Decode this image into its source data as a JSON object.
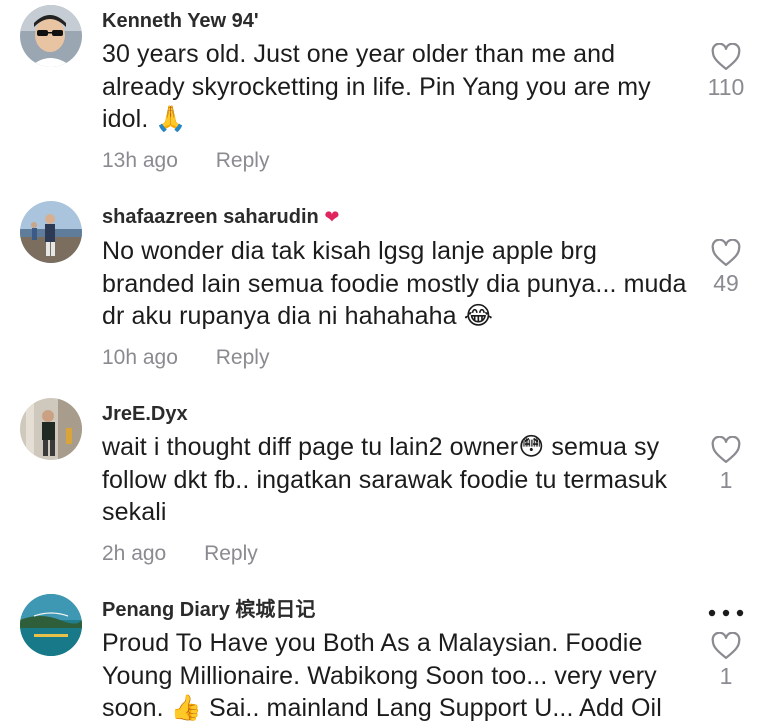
{
  "comments": [
    {
      "username": "Kenneth Yew 94'",
      "text": "30 years old. Just one year older than me and already skyrocketting in life. Pin Yang you are my idol. 🙏",
      "time": "13h ago",
      "reply": "Reply",
      "likes": "110",
      "icon": "heart-outline-icon"
    },
    {
      "username": "shafaazreen saharudin",
      "username_badge": "❤",
      "text": "No wonder dia tak kisah lgsg lanje apple brg branded lain semua foodie mostly dia punya... muda dr aku rupanya dia ni hahahaha 😂",
      "time": "10h ago",
      "reply": "Reply",
      "likes": "49",
      "icon": "heart-outline-icon"
    },
    {
      "username": "JreE.Dyx",
      "text": "wait i thought diff page tu lain2 owner😳 semua sy follow dkt fb.. ingatkan sarawak foodie tu termasuk sekali",
      "time": "2h ago",
      "reply": "Reply",
      "likes": "1",
      "icon": "heart-outline-icon"
    },
    {
      "username": "Penang Diary 槟城日记",
      "text": "Proud To Have you Both As a Malaysian. Foodie Young Millionaire. Wabikong Soon too... very very soon. 👍 Sai.. mainland Lang Support U... Add Oil",
      "likes": "1",
      "icon": "heart-outline-icon",
      "more_icon": "more-dots-icon"
    }
  ],
  "colors": {
    "text": "#1c1c1c",
    "muted": "#8a8b91",
    "heart_badge": "#e0245e"
  }
}
